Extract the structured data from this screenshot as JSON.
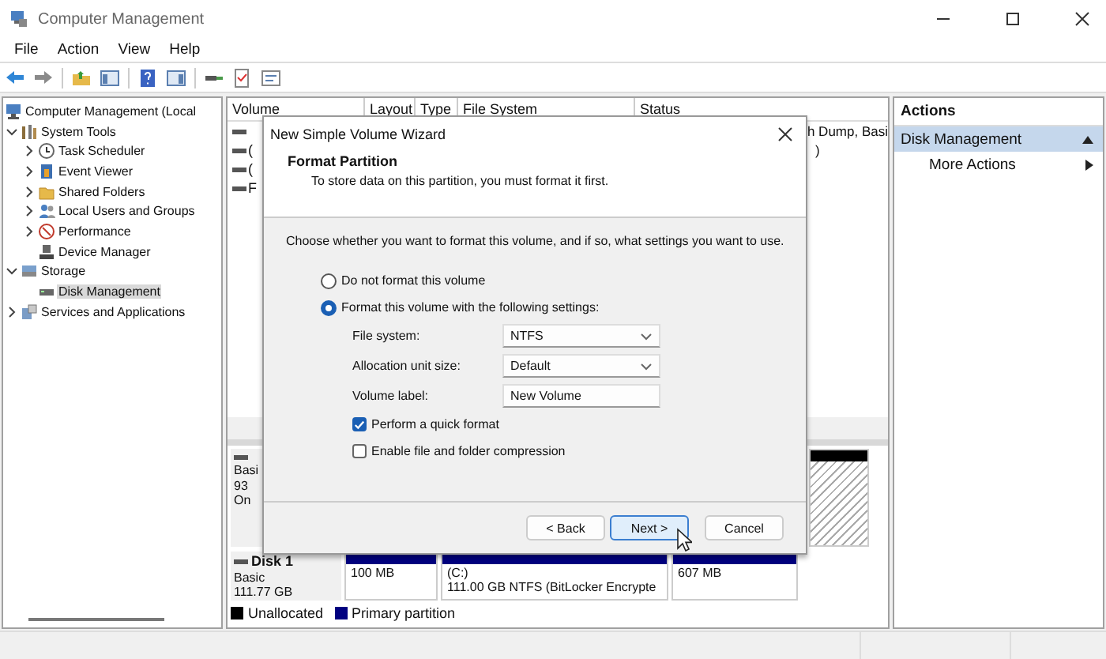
{
  "window": {
    "title": "Computer Management"
  },
  "menu": [
    "File",
    "Action",
    "View",
    "Help"
  ],
  "tree": [
    {
      "label": "Computer Management (Local",
      "selected": false,
      "children": [
        {
          "label": "System Tools",
          "toggle": true,
          "expanded": true,
          "selected": false,
          "children": [
            {
              "label": "Task Scheduler",
              "toggle": true,
              "expanded": false,
              "selected": false
            },
            {
              "label": "Event Viewer",
              "toggle": true,
              "expanded": false,
              "selected": false
            },
            {
              "label": "Shared Folders",
              "toggle": true,
              "expanded": false,
              "selected": false
            },
            {
              "label": "Local Users and Groups",
              "toggle": true,
              "expanded": false,
              "selected": false
            },
            {
              "label": "Performance",
              "toggle": true,
              "expanded": false,
              "selected": false
            },
            {
              "label": "Device Manager",
              "toggle": false,
              "selected": false
            }
          ]
        },
        {
          "label": "Storage",
          "toggle": true,
          "expanded": true,
          "selected": false,
          "children": [
            {
              "label": "Disk Management",
              "toggle": false,
              "selected": true
            }
          ]
        },
        {
          "label": "Services and Applications",
          "toggle": true,
          "expanded": false,
          "selected": false
        }
      ]
    }
  ],
  "table": {
    "columns": [
      "Volume",
      "Layout",
      "Type",
      "File System",
      "Status"
    ],
    "rows": [
      {
        "status": "h Dump, Basi"
      },
      {
        "volume": "(",
        "status": ")"
      },
      {
        "volume": "("
      },
      {
        "volume": "F"
      }
    ]
  },
  "disks": [
    {
      "lines": [
        "Basi",
        "93",
        "On"
      ],
      "partitions": [
        {
          "kind": "unallocated"
        }
      ]
    },
    {
      "name": "Disk 1",
      "lines": [
        "Basic",
        "111.77 GB"
      ],
      "partitions": [
        {
          "kind": "primary",
          "lines": [
            "100 MB"
          ]
        },
        {
          "kind": "primary",
          "lines": [
            "(C:)",
            "111.00 GB NTFS (BitLocker Encrypte"
          ]
        },
        {
          "kind": "primary",
          "lines": [
            "607 MB"
          ]
        }
      ]
    }
  ],
  "legend": [
    {
      "label": "Unallocated",
      "color": "#000000"
    },
    {
      "label": "Primary partition",
      "color": "#000080"
    }
  ],
  "actions": {
    "title": "Actions",
    "items": [
      {
        "label": "Disk Management",
        "kind": "section",
        "selected": true
      },
      {
        "label": "More Actions",
        "kind": "submenu",
        "selected": false
      }
    ]
  },
  "dialog": {
    "title": "New Simple Volume Wizard",
    "heading": "Format Partition",
    "subheading": "To store data on this partition, you must format it first.",
    "instruction": "Choose whether you want to format this volume, and if so, what settings you want to use.",
    "options": [
      {
        "label": "Do not format this volume",
        "selected": false
      },
      {
        "label": "Format this volume with the following settings:",
        "selected": true
      }
    ],
    "fields": [
      {
        "label": "File system:",
        "kind": "dropdown",
        "value": "NTFS"
      },
      {
        "label": "Allocation unit size:",
        "kind": "dropdown",
        "value": "Default"
      },
      {
        "label": "Volume label:",
        "kind": "text",
        "value": "New Volume"
      }
    ],
    "checkboxes": [
      {
        "label": "Perform a quick format",
        "checked": true
      },
      {
        "label": "Enable file and folder compression",
        "checked": false
      }
    ],
    "buttons": [
      {
        "label": "< Back",
        "default": false
      },
      {
        "label": "Next >",
        "default": true
      },
      {
        "label": "Cancel",
        "default": false
      }
    ]
  }
}
